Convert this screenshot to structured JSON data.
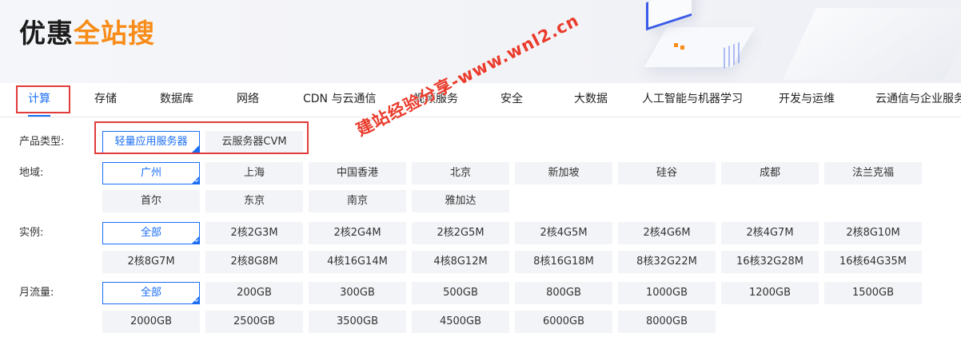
{
  "logo": {
    "text_main": "优惠",
    "text_accent": "全站搜"
  },
  "nav": {
    "items": [
      "计算",
      "存储",
      "数据库",
      "网络",
      "CDN 与云通信",
      "视频服务",
      "安全",
      "大数据",
      "人工智能与机器学习",
      "开发与运维",
      "云通信与企业服务"
    ],
    "active": "计算"
  },
  "filters": {
    "product_type": {
      "label": "产品类型:",
      "options": [
        "轻量应用服务器",
        "云服务器CVM"
      ],
      "selected": "轻量应用服务器"
    },
    "region": {
      "label": "地域:",
      "options": [
        "广州",
        "上海",
        "中国香港",
        "北京",
        "新加坡",
        "硅谷",
        "成都",
        "法兰克福",
        "首尔",
        "东京",
        "南京",
        "雅加达"
      ],
      "selected": "广州"
    },
    "instance": {
      "label": "实例:",
      "options": [
        "全部",
        "2核2G3M",
        "2核2G4M",
        "2核2G5M",
        "2核4G5M",
        "2核4G6M",
        "2核4G7M",
        "2核8G10M",
        "2核8G7M",
        "2核8G8M",
        "4核16G14M",
        "4核8G12M",
        "8核16G18M",
        "8核32G22M",
        "16核32G28M",
        "16核64G35M"
      ],
      "selected": "全部"
    },
    "traffic": {
      "label": "月流量:",
      "options": [
        "全部",
        "200GB",
        "300GB",
        "500GB",
        "800GB",
        "1000GB",
        "1200GB",
        "1500GB",
        "2000GB",
        "2500GB",
        "3500GB",
        "4500GB",
        "6000GB",
        "8000GB"
      ],
      "selected": "全部"
    }
  },
  "watermark": "建站经验分享-www.wnl2.cn",
  "colors": {
    "accent_blue": "#1a6ef5",
    "logo_orange": "#f78c18",
    "highlight_red": "#e23b3b"
  }
}
